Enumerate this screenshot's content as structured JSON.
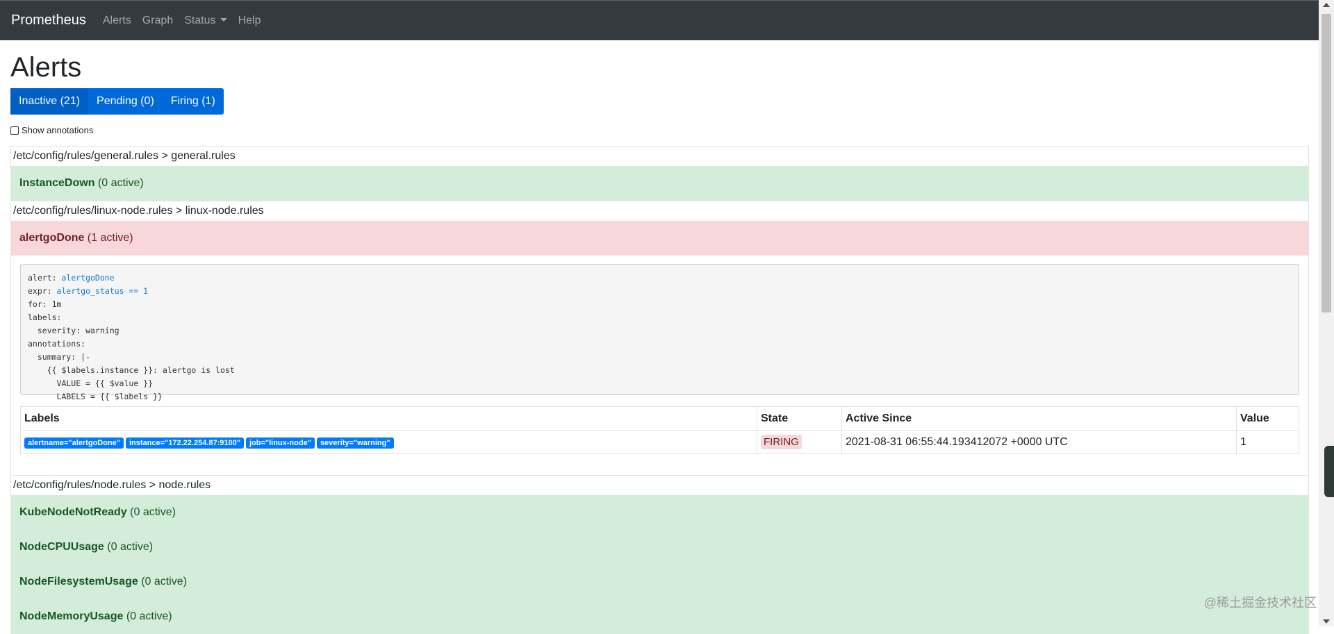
{
  "navbar": {
    "brand": "Prometheus",
    "links": [
      "Alerts",
      "Graph",
      "Status",
      "Help"
    ]
  },
  "page": {
    "title": "Alerts",
    "filters": [
      "Inactive (21)",
      "Pending (0)",
      "Firing (1)"
    ],
    "show_annotations": "Show annotations"
  },
  "groups": {
    "general": {
      "header": "/etc/config/rules/general.rules > general.rules",
      "rules": [
        {
          "name": "InstanceDown",
          "active": "(0 active)"
        }
      ]
    },
    "linux_node": {
      "header": "/etc/config/rules/linux-node.rules > linux-node.rules",
      "rule": {
        "name": "alertgoDone",
        "active": "(1 active)"
      },
      "code": {
        "l1_key": "alert: ",
        "l1_val": "alertgoDone",
        "l2_key": "expr: ",
        "l2_val": "alertgo_status == 1",
        "l3": "for: 1m",
        "l4": "labels:",
        "l5": "  severity: warning",
        "l6": "annotations:",
        "l7": "  summary: |-",
        "l8": "    {{ $labels.instance }}: alertgo is lost",
        "l9": "      VALUE = {{ $value }}",
        "l10": "      LABELS = {{ $labels }}"
      },
      "table": {
        "headers": [
          "Labels",
          "State",
          "Active Since",
          "Value"
        ],
        "row": {
          "labels": [
            "alertname=\"alertgoDone\"",
            "instance=\"172.22.254.87:9100\"",
            "job=\"linux-node\"",
            "severity=\"warning\""
          ],
          "state": "FIRING",
          "active_since": "2021-08-31 06:55:44.193412072 +0000 UTC",
          "value": "1"
        }
      }
    },
    "node": {
      "header": "/etc/config/rules/node.rules > node.rules",
      "rules": [
        {
          "name": "KubeNodeNotReady",
          "active": "(0 active)"
        },
        {
          "name": "NodeCPUUsage",
          "active": "(0 active)"
        },
        {
          "name": "NodeFilesystemUsage",
          "active": "(0 active)"
        },
        {
          "name": "NodeMemoryUsage",
          "active": "(0 active)"
        }
      ]
    }
  },
  "watermark": "@稀土掘金技术社区",
  "colors": {
    "navbar": "#343a40",
    "primary": "#007bff",
    "success_bg": "#d4edda",
    "danger_bg": "#f8d7da"
  }
}
